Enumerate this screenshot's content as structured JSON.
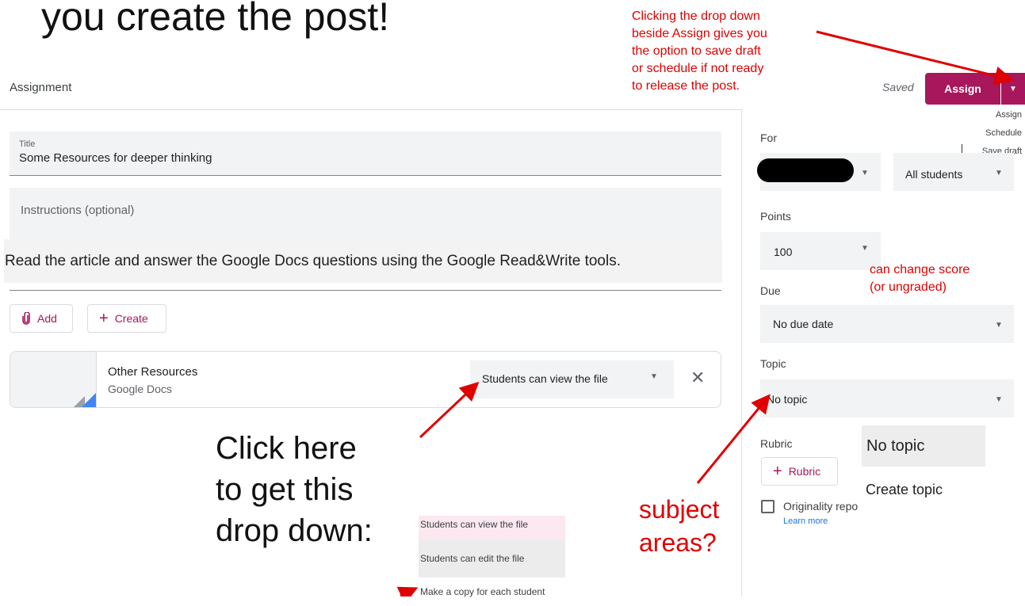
{
  "slide": {
    "title_fragment": "you create the post!"
  },
  "header": {
    "title": "Assignment",
    "saved": "Saved",
    "assign_button": "Assign",
    "assign_dropdown_icon": "caret-down-icon"
  },
  "assign_menu": {
    "items": [
      "Assign",
      "Schedule",
      "Save draft"
    ]
  },
  "callouts": {
    "assign_note": [
      "Clicking the drop down",
      "beside Assign gives you",
      "the option to save draft",
      "or schedule if not ready",
      "to release the post."
    ],
    "score_note": [
      "can change score",
      "(or ungraded)"
    ],
    "click_here": [
      "Click here",
      "to get this",
      "drop down:"
    ],
    "subject_note": [
      "subject",
      "areas?"
    ]
  },
  "form": {
    "title_label": "Title",
    "title_value": "Some Resources for deeper thinking",
    "instructions_placeholder": "Instructions (optional)",
    "instructions_text": "Read the article and answer the Google Docs questions using the Google Read&Write tools.",
    "add_button": "Add",
    "create_button": "Create"
  },
  "attachment": {
    "name": "Other Resources",
    "type": "Google Docs",
    "permission": "Students can view the file"
  },
  "permission_menu": {
    "items": [
      "Students can view the file",
      "Students can edit the file",
      "Make a copy for each student"
    ],
    "highlight_color": "#fce8f0"
  },
  "sidebar": {
    "for_label": "For",
    "students_value": "All students",
    "points_label": "Points",
    "points_value": "100",
    "due_label": "Due",
    "due_value": "No due date",
    "topic_label": "Topic",
    "topic_value": "No topic",
    "rubric_label": "Rubric",
    "rubric_button": "Rubric",
    "originality_label": "Originality repo",
    "learn_more": "Learn more"
  },
  "topic_menu": {
    "items": [
      "No topic",
      "Create topic"
    ]
  },
  "colors": {
    "accent": "#a8165b",
    "annotation": "#e00000"
  }
}
